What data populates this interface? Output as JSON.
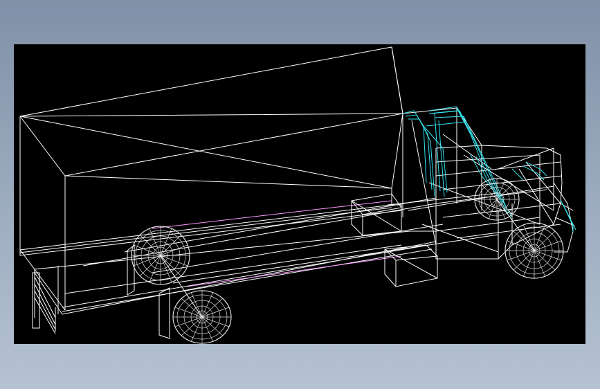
{
  "viewport": {
    "background": "#000000",
    "outer_background": "#8fa0b5"
  },
  "model": {
    "subject": "truck-wireframe",
    "line_colors": {
      "body": "#ffffff",
      "cab_highlight": "#33e6f0",
      "rail_accent": "#ff99ff"
    }
  }
}
